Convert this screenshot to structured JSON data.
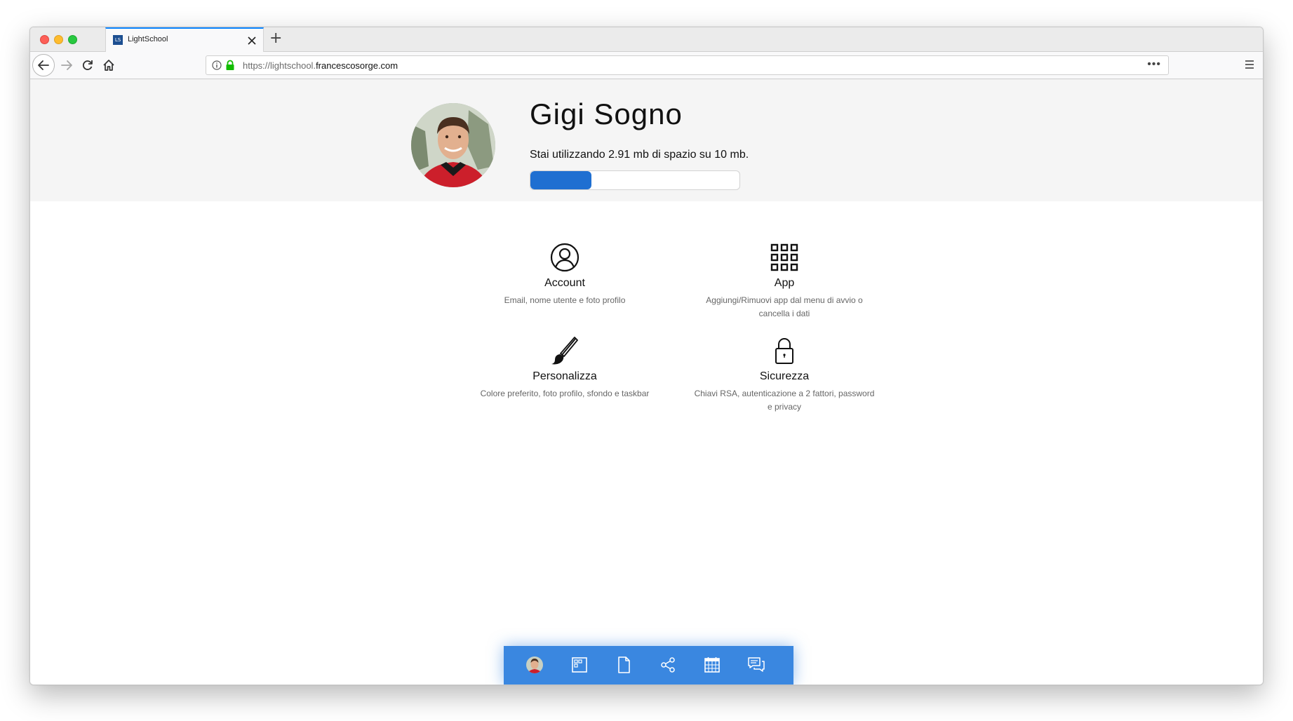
{
  "browser": {
    "tab": {
      "favicon_text": "LS",
      "title": "LightSchool"
    },
    "new_tab_label": "+",
    "url": {
      "prefix": "https://lightschool.",
      "domain": "francescosorge.com"
    },
    "more_label": "•••"
  },
  "profile": {
    "name": "Gigi Sogno",
    "usage_text": "Stai utilizzando 2.91 mb di spazio su 10 mb.",
    "usage_used_mb": 2.91,
    "usage_total_mb": 10
  },
  "settings": [
    {
      "key": "account",
      "icon": "user-circle-icon",
      "title": "Account",
      "description": "Email, nome utente e foto profilo"
    },
    {
      "key": "app",
      "icon": "app-grid-icon",
      "title": "App",
      "description": "Aggiungi/Rimuovi app dal menu di avvio o cancella i dati"
    },
    {
      "key": "personalize",
      "icon": "paintbrush-icon",
      "title": "Personalizza",
      "description": "Colore preferito, foto profilo, sfondo e taskbar"
    },
    {
      "key": "security",
      "icon": "padlock-icon",
      "title": "Sicurezza",
      "description": "Chiavi RSA, autenticazione a 2 fattori, password e privacy"
    }
  ],
  "taskbar": {
    "items": [
      "avatar",
      "window-icon",
      "file-icon",
      "share-icon",
      "calendar-icon",
      "chat-icon"
    ],
    "color": "#3a87e0"
  },
  "colors": {
    "accent": "#1f6fd1",
    "header_band": "#f5f5f5"
  }
}
